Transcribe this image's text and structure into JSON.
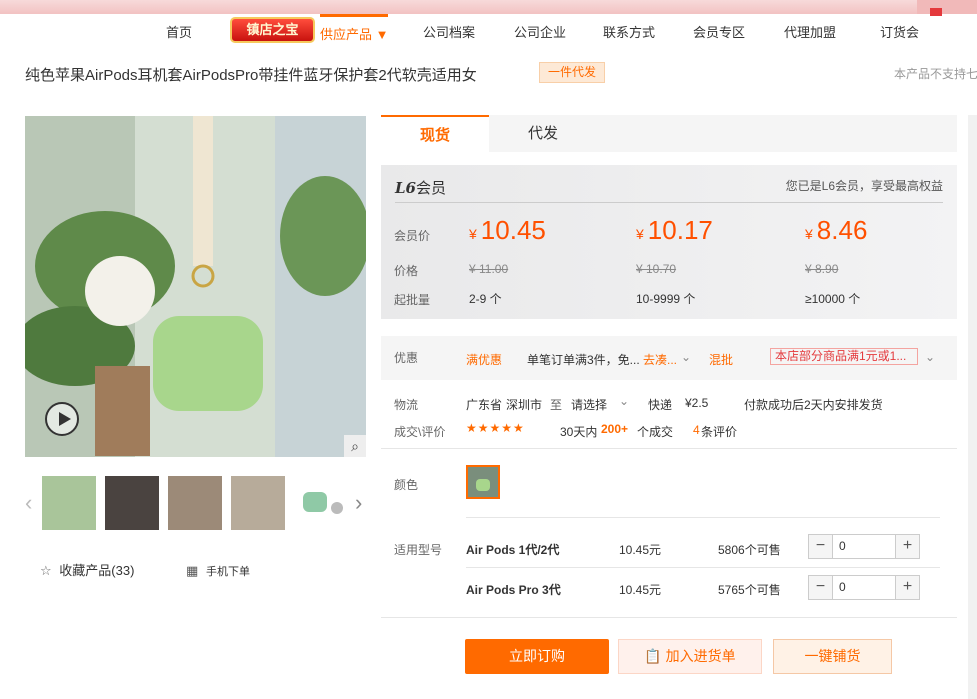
{
  "nav": {
    "items": [
      "首页",
      "供应产品 ▼",
      "公司档案",
      "公司企业",
      "联系方式",
      "会员专区",
      "代理加盟",
      "订货会"
    ],
    "treasure_label": "镇店之宝"
  },
  "product": {
    "title": "纯色苹果AirPods耳机套AirPodsPro带挂件蓝牙保护套2代软壳适用女",
    "tag": "一件代发",
    "notice": "本产品不支持七"
  },
  "gallery": {
    "collect": "收藏产品(33)",
    "mobile": "手机下单"
  },
  "tabs": [
    "现货",
    "代发"
  ],
  "member": {
    "level": "L6",
    "level_suffix": "会员",
    "note": "您已是L6会员，享受最高权益",
    "row_labels": [
      "会员价",
      "价格",
      "起批量"
    ],
    "currency": "¥",
    "tiers": [
      {
        "price": "10.45",
        "old": "¥ 11.00",
        "qty": "2-9 个"
      },
      {
        "price": "10.17",
        "old": "¥ 10.70",
        "qty": "10-9999 个"
      },
      {
        "price": "8.46",
        "old": "¥ 8.90",
        "qty": "≥10000 个"
      }
    ]
  },
  "promo": {
    "label": "优惠",
    "tag1": "满优惠",
    "text1": "单笔订单满3件，免...",
    "link1": "去凑...",
    "tag2": "混批",
    "box": "本店部分商品满1元或1..."
  },
  "logistics": {
    "label": "物流",
    "province": "广东省",
    "city": "深圳市",
    "to": "至",
    "dest": "请选择",
    "method": "快递",
    "fee": "¥2.5",
    "ship_note": "付款成功后2天内安排发货"
  },
  "deals": {
    "label": "成交\\评价",
    "stars": "★★★★★",
    "days": "30天内",
    "count": "200+",
    "count_suffix": "个成交",
    "reviews": "4",
    "reviews_suffix": "条评价"
  },
  "color": {
    "label": "颜色"
  },
  "models": {
    "label": "适用型号",
    "rows": [
      {
        "name": "Air Pods 1代/2代",
        "price": "10.45元",
        "stock": "5806个可售",
        "qty": "0"
      },
      {
        "name": "Air Pods Pro 3代",
        "price": "10.45元",
        "stock": "5765个可售",
        "qty": "0"
      }
    ]
  },
  "buttons": {
    "buy": "立即订购",
    "cart": "加入进货单",
    "ship": "一键铺货"
  },
  "colors": {
    "accent": "#ff6a00",
    "price": "#ff5000"
  }
}
